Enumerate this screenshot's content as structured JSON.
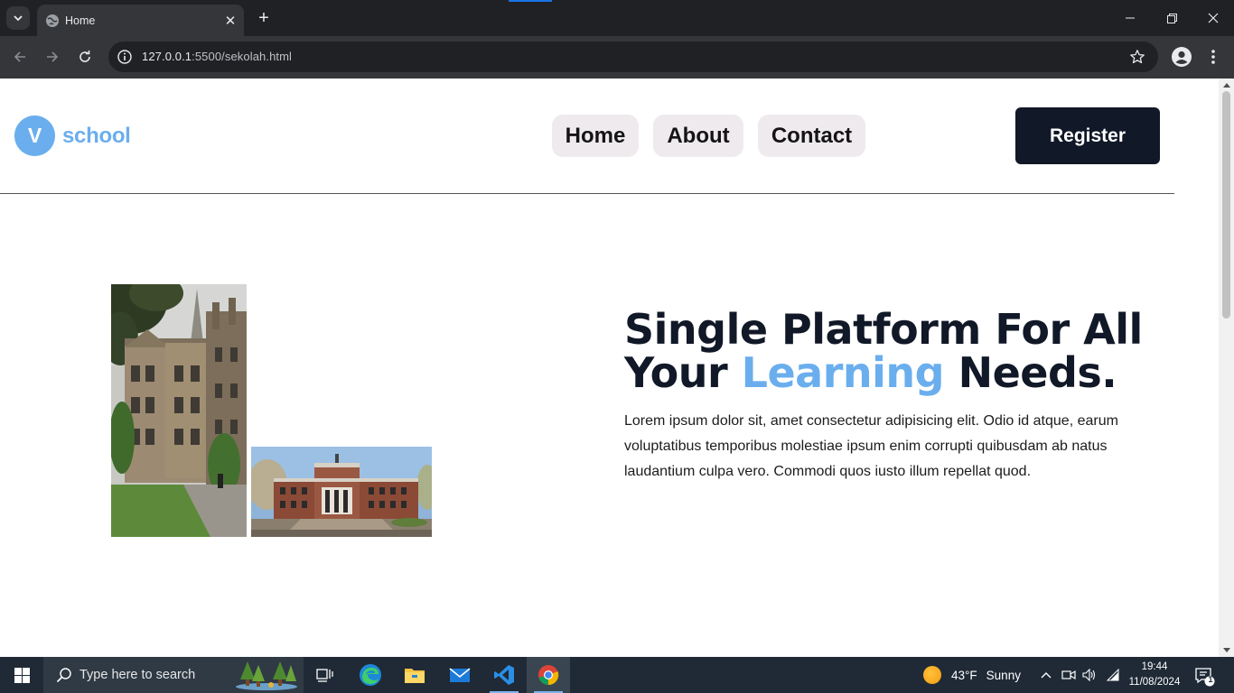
{
  "browser": {
    "tab_title": "Home",
    "url_host": "127.0.0.1",
    "url_rest": ":5500/sekolah.html"
  },
  "site": {
    "logo_letter": "V",
    "logo_text": "school",
    "nav": [
      "Home",
      "About",
      "Contact"
    ],
    "register_label": "Register",
    "hero": {
      "title_part1": "Single Platform For All Your ",
      "title_accent": "Learning",
      "title_part2": " Needs.",
      "body": "Lorem ipsum dolor sit, amet consectetur adipisicing elit. Odio id atque, earum voluptatibus temporibus molestiae ipsum enim corrupti quibusdam ab natus laudantium culpa vero. Commodi quos iusto illum repellat quod."
    },
    "colors": {
      "accent": "#6aaeee",
      "dark": "#111827",
      "nav_bg": "#efeaee"
    }
  },
  "taskbar": {
    "search_placeholder": "Type here to search",
    "weather_temp": "43°F",
    "weather_desc": "Sunny",
    "time": "19:44",
    "date": "11/08/2024",
    "notification_count": "1"
  }
}
